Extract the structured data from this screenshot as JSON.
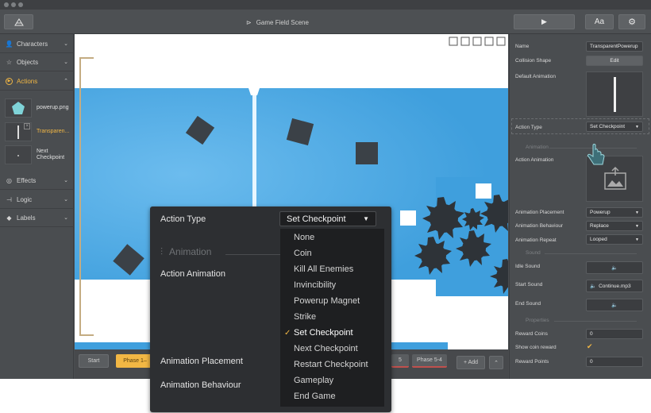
{
  "window": {
    "scene_title": "Game Field Scene",
    "toolbar": {
      "play_icon": "play-icon",
      "font_label": "Aa",
      "settings_icon": "gear-icon",
      "home_icon": "home-icon"
    }
  },
  "sidebar": {
    "items": [
      {
        "label": "Characters",
        "icon": "person-icon"
      },
      {
        "label": "Objects",
        "icon": "star-icon"
      },
      {
        "label": "Actions",
        "icon": "play-circle-icon"
      },
      {
        "label": "Effects",
        "icon": "effects-icon"
      },
      {
        "label": "Logic",
        "icon": "logic-icon"
      },
      {
        "label": "Labels",
        "icon": "tag-icon"
      }
    ],
    "assets": [
      {
        "label": "powerup.png"
      },
      {
        "label": "Transparen..."
      },
      {
        "label": "Next Checkpoint"
      }
    ]
  },
  "bottombar": {
    "start_label": "Start",
    "phase_first": "Phase 1–",
    "phase_mid": "5",
    "phase_last": "Phase 5-4",
    "add_label": "+ Add",
    "up_icon": "chevron-up-icon"
  },
  "inspector": {
    "name_label": "Name",
    "name_value": "TransparentPowerup",
    "collision_label": "Collision Shape",
    "edit_label": "Edit",
    "default_anim_label": "Default Animation",
    "action_type_label": "Action Type",
    "action_type_value": "Set Checkpoint",
    "animation_section": "Animation",
    "action_anim_label": "Action Animation",
    "anim_placement_label": "Animation Placement",
    "anim_placement_value": "Powerup",
    "anim_behaviour_label": "Animation Behaviour",
    "anim_behaviour_value": "Replace",
    "anim_repeat_label": "Animation Repeat",
    "anim_repeat_value": "Looped",
    "sound_section": "Sound",
    "idle_sound_label": "Idle Sound",
    "start_sound_label": "Start Sound",
    "start_sound_value": "Continue.mp3",
    "end_sound_label": "End Sound",
    "properties_section": "Properties",
    "reward_coins_label": "Reward Coins",
    "reward_coins_value": "0",
    "show_coin_reward_label": "Show coin reward",
    "reward_points_label": "Reward Points",
    "reward_points_value": "0"
  },
  "popup": {
    "action_type_label": "Action Type",
    "selected_value": "Set Checkpoint",
    "animation_section": "Animation",
    "action_animation_label": "Action Animation",
    "anim_placement_label": "Animation Placement",
    "anim_behaviour_label": "Animation Behaviour",
    "options": [
      "None",
      "Coin",
      "Kill All Enemies",
      "Invincibility",
      "Powerup Magnet",
      "Strike",
      "Set Checkpoint",
      "Next Checkpoint",
      "Restart Checkpoint",
      "Gameplay",
      "End Game"
    ],
    "selected_index": 6
  },
  "colors": {
    "accent": "#f2b744",
    "sky": "#3f9fdd",
    "sky_light": "#6cbcee",
    "obstacle": "#3b4147"
  }
}
